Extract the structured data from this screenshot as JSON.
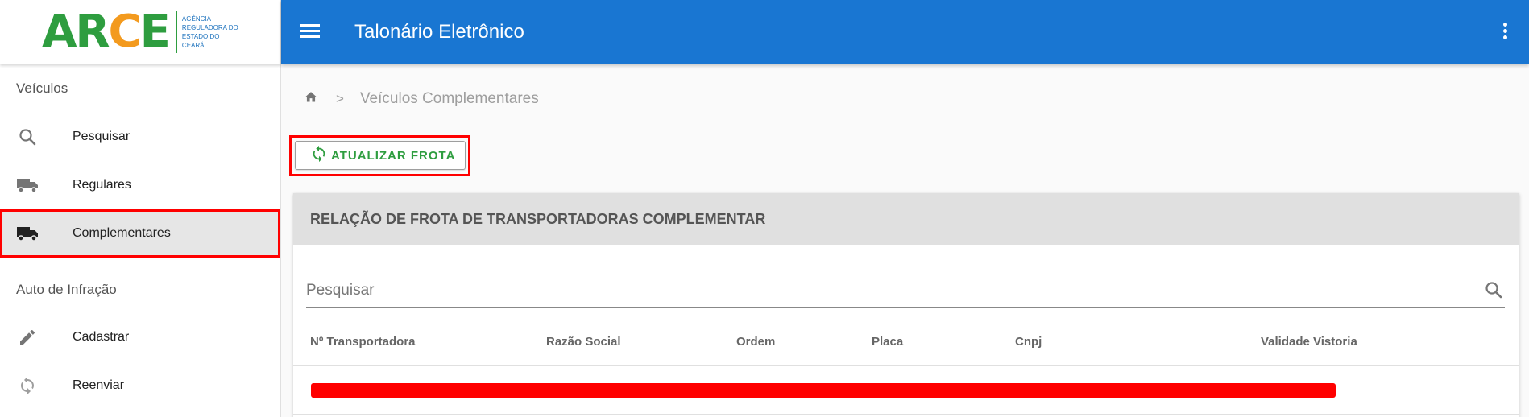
{
  "logo": {
    "word_a": "A",
    "word_r": "R",
    "word_c": "C",
    "word_e": "E",
    "sub": "Agência Reguladora do Estado do Ceará"
  },
  "sidebar": {
    "section1": "Veículos",
    "items1": [
      {
        "label": "Pesquisar",
        "icon": "search-icon"
      },
      {
        "label": "Regulares",
        "icon": "truck-icon"
      },
      {
        "label": "Complementares",
        "icon": "truck-icon"
      }
    ],
    "section2": "Auto de Infração",
    "items2": [
      {
        "label": "Cadastrar",
        "icon": "pencil-icon"
      },
      {
        "label": "Reenviar",
        "icon": "sync-icon"
      }
    ]
  },
  "topbar": {
    "title": "Talonário Eletrônico",
    "menu_icon": "hamburger-icon",
    "more_icon": "more-vert-icon"
  },
  "breadcrumb": {
    "home_icon": "home-icon",
    "separator": ">",
    "current": "Veículos Complementares"
  },
  "update_button": {
    "label": "ATUALIZAR FROTA",
    "icon": "sync-icon"
  },
  "card": {
    "title": "RELAÇÃO DE FROTA DE TRANSPORTADORAS COMPLEMENTAR",
    "search": {
      "placeholder": "Pesquisar",
      "value": ""
    },
    "columns": [
      "Nº Transportadora",
      "Razão Social",
      "Ordem",
      "Placa",
      "Cnpj",
      "Validade Vistoria"
    ]
  },
  "colors": {
    "primary": "#1976d2",
    "accent_green": "#2e9d3f",
    "logo_orange": "#f39a1e",
    "highlight_red": "#ff0000"
  }
}
